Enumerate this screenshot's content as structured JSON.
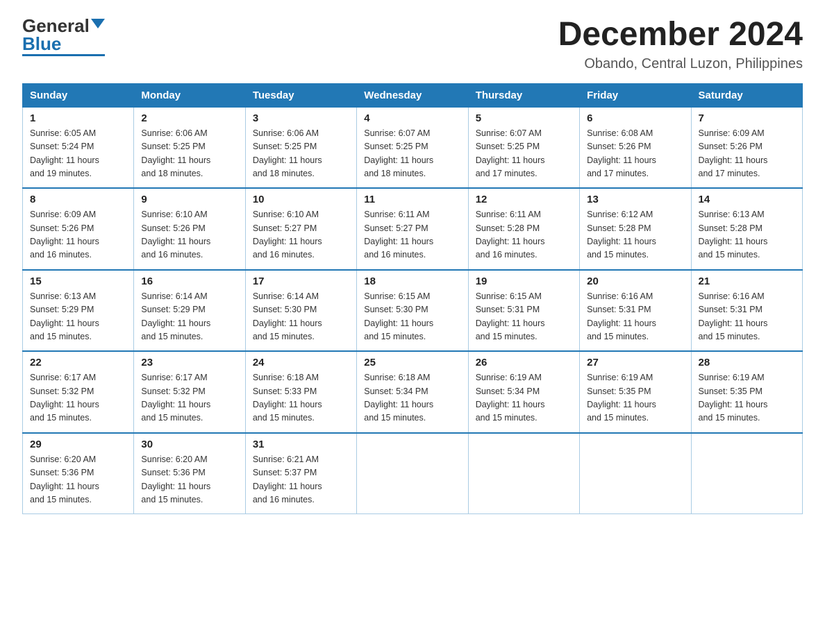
{
  "header": {
    "logo_general": "General",
    "logo_blue": "Blue",
    "month_title": "December 2024",
    "location": "Obando, Central Luzon, Philippines"
  },
  "days_of_week": [
    "Sunday",
    "Monday",
    "Tuesday",
    "Wednesday",
    "Thursday",
    "Friday",
    "Saturday"
  ],
  "weeks": [
    [
      {
        "day": "1",
        "info": "Sunrise: 6:05 AM\nSunset: 5:24 PM\nDaylight: 11 hours\nand 19 minutes."
      },
      {
        "day": "2",
        "info": "Sunrise: 6:06 AM\nSunset: 5:25 PM\nDaylight: 11 hours\nand 18 minutes."
      },
      {
        "day": "3",
        "info": "Sunrise: 6:06 AM\nSunset: 5:25 PM\nDaylight: 11 hours\nand 18 minutes."
      },
      {
        "day": "4",
        "info": "Sunrise: 6:07 AM\nSunset: 5:25 PM\nDaylight: 11 hours\nand 18 minutes."
      },
      {
        "day": "5",
        "info": "Sunrise: 6:07 AM\nSunset: 5:25 PM\nDaylight: 11 hours\nand 17 minutes."
      },
      {
        "day": "6",
        "info": "Sunrise: 6:08 AM\nSunset: 5:26 PM\nDaylight: 11 hours\nand 17 minutes."
      },
      {
        "day": "7",
        "info": "Sunrise: 6:09 AM\nSunset: 5:26 PM\nDaylight: 11 hours\nand 17 minutes."
      }
    ],
    [
      {
        "day": "8",
        "info": "Sunrise: 6:09 AM\nSunset: 5:26 PM\nDaylight: 11 hours\nand 16 minutes."
      },
      {
        "day": "9",
        "info": "Sunrise: 6:10 AM\nSunset: 5:26 PM\nDaylight: 11 hours\nand 16 minutes."
      },
      {
        "day": "10",
        "info": "Sunrise: 6:10 AM\nSunset: 5:27 PM\nDaylight: 11 hours\nand 16 minutes."
      },
      {
        "day": "11",
        "info": "Sunrise: 6:11 AM\nSunset: 5:27 PM\nDaylight: 11 hours\nand 16 minutes."
      },
      {
        "day": "12",
        "info": "Sunrise: 6:11 AM\nSunset: 5:28 PM\nDaylight: 11 hours\nand 16 minutes."
      },
      {
        "day": "13",
        "info": "Sunrise: 6:12 AM\nSunset: 5:28 PM\nDaylight: 11 hours\nand 15 minutes."
      },
      {
        "day": "14",
        "info": "Sunrise: 6:13 AM\nSunset: 5:28 PM\nDaylight: 11 hours\nand 15 minutes."
      }
    ],
    [
      {
        "day": "15",
        "info": "Sunrise: 6:13 AM\nSunset: 5:29 PM\nDaylight: 11 hours\nand 15 minutes."
      },
      {
        "day": "16",
        "info": "Sunrise: 6:14 AM\nSunset: 5:29 PM\nDaylight: 11 hours\nand 15 minutes."
      },
      {
        "day": "17",
        "info": "Sunrise: 6:14 AM\nSunset: 5:30 PM\nDaylight: 11 hours\nand 15 minutes."
      },
      {
        "day": "18",
        "info": "Sunrise: 6:15 AM\nSunset: 5:30 PM\nDaylight: 11 hours\nand 15 minutes."
      },
      {
        "day": "19",
        "info": "Sunrise: 6:15 AM\nSunset: 5:31 PM\nDaylight: 11 hours\nand 15 minutes."
      },
      {
        "day": "20",
        "info": "Sunrise: 6:16 AM\nSunset: 5:31 PM\nDaylight: 11 hours\nand 15 minutes."
      },
      {
        "day": "21",
        "info": "Sunrise: 6:16 AM\nSunset: 5:31 PM\nDaylight: 11 hours\nand 15 minutes."
      }
    ],
    [
      {
        "day": "22",
        "info": "Sunrise: 6:17 AM\nSunset: 5:32 PM\nDaylight: 11 hours\nand 15 minutes."
      },
      {
        "day": "23",
        "info": "Sunrise: 6:17 AM\nSunset: 5:32 PM\nDaylight: 11 hours\nand 15 minutes."
      },
      {
        "day": "24",
        "info": "Sunrise: 6:18 AM\nSunset: 5:33 PM\nDaylight: 11 hours\nand 15 minutes."
      },
      {
        "day": "25",
        "info": "Sunrise: 6:18 AM\nSunset: 5:34 PM\nDaylight: 11 hours\nand 15 minutes."
      },
      {
        "day": "26",
        "info": "Sunrise: 6:19 AM\nSunset: 5:34 PM\nDaylight: 11 hours\nand 15 minutes."
      },
      {
        "day": "27",
        "info": "Sunrise: 6:19 AM\nSunset: 5:35 PM\nDaylight: 11 hours\nand 15 minutes."
      },
      {
        "day": "28",
        "info": "Sunrise: 6:19 AM\nSunset: 5:35 PM\nDaylight: 11 hours\nand 15 minutes."
      }
    ],
    [
      {
        "day": "29",
        "info": "Sunrise: 6:20 AM\nSunset: 5:36 PM\nDaylight: 11 hours\nand 15 minutes."
      },
      {
        "day": "30",
        "info": "Sunrise: 6:20 AM\nSunset: 5:36 PM\nDaylight: 11 hours\nand 15 minutes."
      },
      {
        "day": "31",
        "info": "Sunrise: 6:21 AM\nSunset: 5:37 PM\nDaylight: 11 hours\nand 16 minutes."
      },
      {
        "day": "",
        "info": ""
      },
      {
        "day": "",
        "info": ""
      },
      {
        "day": "",
        "info": ""
      },
      {
        "day": "",
        "info": ""
      }
    ]
  ],
  "accent_color": "#2278b5"
}
